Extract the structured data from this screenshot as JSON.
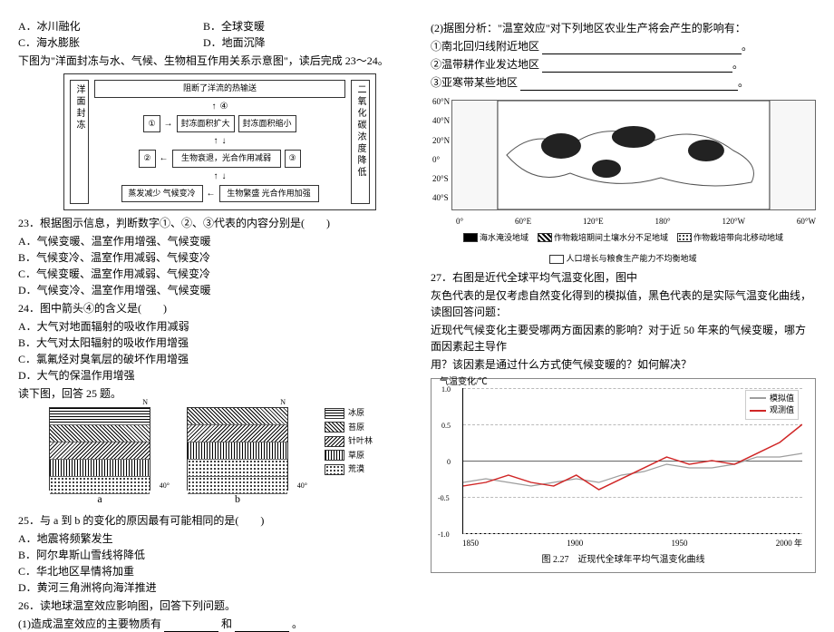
{
  "left": {
    "q22": {
      "optA": "A．冰川融化",
      "optB": "B．全球变暖",
      "optC": "C．海水膨胀",
      "optD": "D．地面沉降"
    },
    "intro23": "下图为\"洋面封冻与水、气候、生物相互作用关系示意图\"，读后完成 23～24。",
    "diagram": {
      "top": "阻断了洋流的热输送",
      "mark4": "④",
      "left_vert": "洋面封冻",
      "right_vert": "二氧化碳浓度降低",
      "n1": "①",
      "a1": "封冻面积扩大",
      "a2": "封冻面积缩小",
      "n2": "②",
      "b1": "生物衰退，光合作用减弱",
      "n3": "③",
      "c1": "蒸发减少 气候变冷",
      "c2": "生物繁盛 光合作用加强"
    },
    "q23": {
      "stem": "23．根据图示信息，判断数字①、②、③代表的内容分别是(　　)",
      "A": "A．气候变暖、温室作用增强、气候变暖",
      "B": "B．气候变冷、温室作用减弱、气候变冷",
      "C": "C．气候变暖、温室作用减弱、气候变冷",
      "D": "D．气候变冷、温室作用增强、气候变暖"
    },
    "q24": {
      "stem": "24．图中箭头④的含义是(　　)",
      "A": "A．大气对地面辐射的吸收作用减弱",
      "B": "B．大气对太阳辐射的吸收作用增强",
      "C": "C．氯氟烃对臭氧层的破坏作用增强",
      "D": "D．大气的保温作用增强"
    },
    "intro25": "读下图，回答 25 题。",
    "mini_labels": {
      "N": "N",
      "lat40": "40°",
      "a": "a",
      "b": "b",
      "legend": {
        "l1": "冰原",
        "l2": "苔原",
        "l3": "针叶林",
        "l4": "草原",
        "l5": "荒漠"
      }
    },
    "q25": {
      "stem": "25．与 a 到 b 的变化的原因最有可能相同的是(　　)",
      "A": "A．地震将频繁发生",
      "B": "B．阿尔卑斯山雪线将降低",
      "C": "C．华北地区旱情将加重",
      "D": "D．黄河三角洲将向海洋推进"
    },
    "q26": {
      "stem": "26．读地球温室效应影响图，回答下列问题。",
      "p1_a": "(1)造成温室效应的主要物质有",
      "p1_b": "和",
      "p1_c": "。"
    }
  },
  "right": {
    "p2head": "(2)据图分析：\"温室效应\"对下列地区农业生产将会产生的影响有：",
    "p2a": "①南北回归线附近地区",
    "p2b": "②温带耕作业发达地区",
    "p2c": "③亚寒带某些地区",
    "map": {
      "lat": [
        "60°N",
        "40°N",
        "20°N",
        "0°",
        "20°S",
        "40°S"
      ],
      "lon": [
        "0°",
        "60°E",
        "120°E",
        "180°",
        "120°W",
        "60°W"
      ],
      "legend": {
        "a": "海水淹没地域",
        "b": "作物栽培期间土壤水分不足地域",
        "c": "作物栽培带向北移动地域",
        "d": "人口增长与粮食生产能力不均衡地域"
      }
    },
    "q27": {
      "stem": "27．右图是近代全球平均气温变化图，图中",
      "para": "灰色代表的是仅考虑自然变化得到的模拟值，黑色代表的是实际气温变化曲线，读图回答问题：",
      "para2": "近现代气候变化主要受哪两方面因素的影响？对于近 50 年来的气候变暖，哪方面因素起主导作",
      "para3": "用？该因素是通过什么方式使气候变暖的？如何解决？"
    },
    "chart": {
      "ytitle": "气温变化/℃",
      "legend_sim": "模拟值",
      "legend_obs": "观测值",
      "caption": "图 2.27　近现代全球年平均气温变化曲线"
    }
  },
  "chart_data": {
    "type": "line",
    "title": "近现代全球年平均气温变化曲线",
    "xlabel": "年",
    "ylabel": "气温变化/℃",
    "xlim": [
      1850,
      2000
    ],
    "ylim": [
      -1.0,
      1.0
    ],
    "yticks": [
      -1.0,
      -0.5,
      0,
      0.5,
      1.0
    ],
    "xticks": [
      1850,
      1900,
      1950,
      2000
    ],
    "series": [
      {
        "name": "模拟值",
        "color": "#9e9e9e",
        "x": [
          1850,
          1860,
          1870,
          1880,
          1890,
          1900,
          1910,
          1920,
          1930,
          1940,
          1950,
          1960,
          1970,
          1980,
          1990,
          2000
        ],
        "y": [
          -0.3,
          -0.25,
          -0.3,
          -0.35,
          -0.3,
          -0.25,
          -0.3,
          -0.2,
          -0.15,
          -0.05,
          -0.1,
          -0.1,
          -0.05,
          0.05,
          0.05,
          0.1
        ]
      },
      {
        "name": "观测值",
        "color": "#d02626",
        "x": [
          1850,
          1860,
          1870,
          1880,
          1890,
          1900,
          1910,
          1920,
          1930,
          1940,
          1950,
          1960,
          1970,
          1980,
          1990,
          2000
        ],
        "y": [
          -0.35,
          -0.3,
          -0.2,
          -0.3,
          -0.35,
          -0.2,
          -0.4,
          -0.25,
          -0.1,
          0.05,
          -0.05,
          0.0,
          -0.05,
          0.1,
          0.25,
          0.5
        ]
      }
    ]
  }
}
